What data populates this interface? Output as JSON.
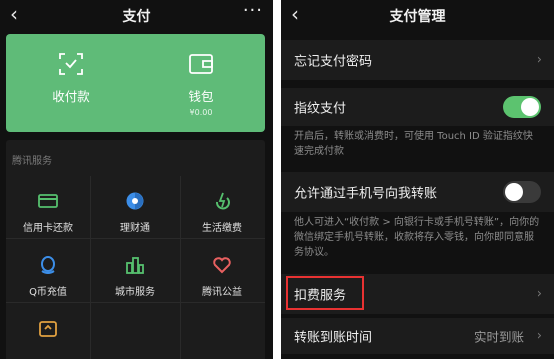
{
  "left": {
    "nav": {
      "back": "‹",
      "title": "支付",
      "more": "···"
    },
    "card": {
      "receive": {
        "label": "收付款"
      },
      "wallet": {
        "label": "钱包",
        "amount": "¥0.00"
      }
    },
    "services": {
      "heading": "腾讯服务",
      "items": [
        {
          "label": "信用卡还款",
          "icon": "credit-card-icon",
          "color": "#56c06e"
        },
        {
          "label": "理财通",
          "icon": "wealth-icon",
          "color": "#3c8ee8"
        },
        {
          "label": "生活缴费",
          "icon": "utility-icon",
          "color": "#56c06e"
        },
        {
          "label": "Q币充值",
          "icon": "qq-coin-icon",
          "color": "#3c8ee8"
        },
        {
          "label": "城市服务",
          "icon": "city-icon",
          "color": "#56c06e"
        },
        {
          "label": "腾讯公益",
          "icon": "charity-heart-icon",
          "color": "#e86060"
        }
      ]
    }
  },
  "right": {
    "nav": {
      "back": "‹",
      "title": "支付管理"
    },
    "forgot_pwd": {
      "label": "忘记支付密码"
    },
    "fingerprint": {
      "label": "指纹支付",
      "enabled": true
    },
    "fingerprint_desc": "开启后，转账或消费时，可使用 Touch ID 验证指纹快速完成付款",
    "phone_transfer": {
      "label": "允许通过手机号向我转账",
      "enabled": false
    },
    "phone_desc": "他人可进入“收付款 > 向银行卡或手机号转账”，向你的微信绑定手机号转账，收款将存入零钱，向你即同意服务协议。",
    "deduction": {
      "label": "扣费服务"
    },
    "arrival_time": {
      "label": "转账到账时间",
      "value": "实时到账"
    },
    "chevron": "›",
    "accent": "#5cc36f"
  }
}
